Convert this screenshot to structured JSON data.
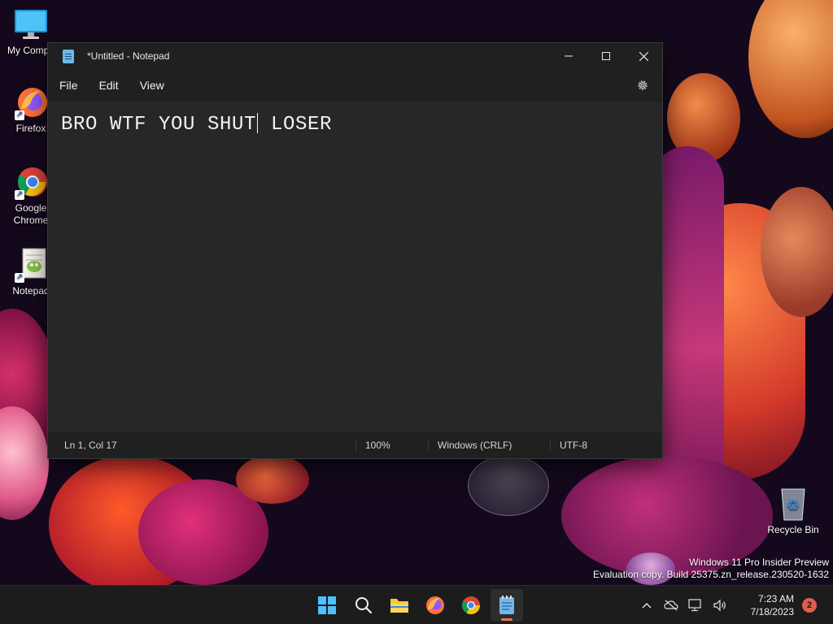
{
  "desktop": {
    "icons": [
      {
        "label": "My Compu",
        "icon": "monitor-icon"
      },
      {
        "label": "Firefox",
        "icon": "firefox-icon"
      },
      {
        "label": "Google\nChrome",
        "icon": "chrome-icon"
      },
      {
        "label": "Notepad",
        "icon": "notepad-plus-icon"
      },
      {
        "label": "Recycle Bin",
        "icon": "recycle-bin-icon"
      }
    ],
    "watermark": {
      "line1": "Windows 11 Pro Insider Preview",
      "line2": "Evaluation copy. Build 25375.zn_release.230520-1632"
    }
  },
  "notepad": {
    "title": "*Untitled - Notepad",
    "menu": [
      "File",
      "Edit",
      "View"
    ],
    "text_before_caret": "BRO WTF YOU SHUT",
    "text_after_caret": " LOSER",
    "status": {
      "position": "Ln 1, Col 17",
      "zoom": "100%",
      "line_ending": "Windows (CRLF)",
      "encoding": "UTF-8"
    }
  },
  "taskbar": {
    "apps": [
      "start-icon",
      "search-icon",
      "file-explorer-icon",
      "firefox-icon",
      "chrome-icon",
      "notepad-icon"
    ],
    "active_app": "notepad-icon",
    "clock": {
      "time": "7:23 AM",
      "date": "7/18/2023"
    },
    "notification_count": "2"
  },
  "colors": {
    "window_bg": "#272727",
    "titlebar_bg": "#202020",
    "taskbar_bg": "#1c1c1c",
    "active_indicator": "#e8754a",
    "notification_badge": "#e05c4e"
  }
}
